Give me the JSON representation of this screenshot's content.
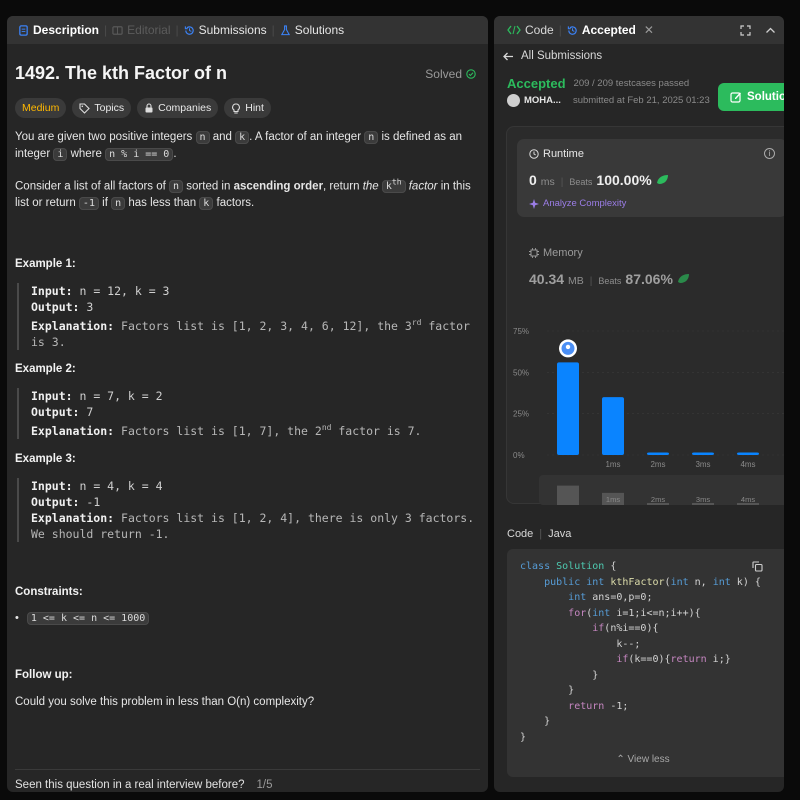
{
  "left_tabs": {
    "description": "Description",
    "editorial": "Editorial",
    "submissions": "Submissions",
    "solutions": "Solutions"
  },
  "problem": {
    "title": "1492. The kth Factor of n",
    "status": "Solved",
    "tags": {
      "difficulty": "Medium",
      "topics": "Topics",
      "companies": "Companies",
      "hint": "Hint"
    },
    "para1": {
      "t1": "You are given two positive integers ",
      "c1": "n",
      "t2": " and ",
      "c2": "k",
      "t3": ". A factor of an integer ",
      "c3": "n",
      "t4": " is defined as an integer ",
      "c4": "i",
      "t5": " where ",
      "c5": "n % i == 0",
      "t6": "."
    },
    "para2": {
      "t1": "Consider a list of all factors of ",
      "c1": "n",
      "t2": " sorted in ",
      "bold": "ascending order",
      "t3": ", return ",
      "i1": "the ",
      "c2": "k",
      "sup": "th",
      "i2": " factor",
      "t4": " in this list or return ",
      "c3": "-1",
      "t5": " if ",
      "c4": "n",
      "t6": " has less than ",
      "c5": "k",
      "t7": " factors."
    },
    "examples": [
      {
        "title": "Example 1:",
        "input_label": "Input:",
        "input": " n = 12, k = 3",
        "output_label": "Output:",
        "output": " 3",
        "expl_label": "Explanation:",
        "expl_a": " Factors list is [1, 2, 3, 4, 6, 12], the 3",
        "expl_sup": "rd",
        "expl_b": " factor",
        "expl_c": "is 3."
      },
      {
        "title": "Example 2:",
        "input_label": "Input:",
        "input": " n = 7, k = 2",
        "output_label": "Output:",
        "output": " 7",
        "expl_label": "Explanation:",
        "expl_a": " Factors list is [1, 7], the 2",
        "expl_sup": "nd",
        "expl_b": " factor is 7."
      },
      {
        "title": "Example 3:",
        "input_label": "Input:",
        "input": " n = 4, k = 4",
        "output_label": "Output:",
        "output": " -1",
        "expl_label": "Explanation:",
        "expl_a": " Factors list is [1, 2, 4], there is only 3 factors.",
        "expl_c": "We should return -1."
      }
    ],
    "constraints_title": "Constraints:",
    "constraint_1": "1 <= k <= n <= 1000",
    "followup_title": "Follow up:",
    "followup_text": "Could you solve this problem in less than O(n) complexity?",
    "footer_question": "Seen this question in a real interview before?",
    "footer_page": "1/5"
  },
  "right_tabs": {
    "code": "Code",
    "accepted": "Accepted"
  },
  "submission": {
    "back_label": "All Submissions",
    "status": "Accepted",
    "testcases": "209 / 209 testcases passed",
    "user": "MOHA...",
    "submitted": "submitted at Feb 21, 2025 01:23",
    "solution_button": "Solutio"
  },
  "runtime": {
    "label": "Runtime",
    "value": "0",
    "unit": "ms",
    "beats_label": "Beats",
    "beats": "100.00%",
    "analyze": "Analyze Complexity"
  },
  "memory": {
    "label": "Memory",
    "value": "40.34",
    "unit": "MB",
    "beats_label": "Beats",
    "beats": "87.06%"
  },
  "chart_data": {
    "type": "bar",
    "categories": [
      "0ms",
      "1ms",
      "2ms",
      "3ms",
      "4ms"
    ],
    "x_tick_labels": [
      "",
      "1ms",
      "2ms",
      "3ms",
      "4ms"
    ],
    "values": [
      56,
      35,
      1.5,
      1.5,
      1.5
    ],
    "y_ticks": [
      "0%",
      "25%",
      "50%",
      "75%"
    ],
    "ylim": [
      0,
      75
    ],
    "highlighted_category": "0ms",
    "colors": {
      "bar": "#0a84ff",
      "axis_text": "#8a8a8a",
      "grid": "#3a3a3a"
    },
    "scrubber_labels": [
      "1ms",
      "2ms",
      "3ms",
      "4ms"
    ]
  },
  "code": {
    "label": "Code",
    "language": "Java",
    "view_less": "View less"
  }
}
